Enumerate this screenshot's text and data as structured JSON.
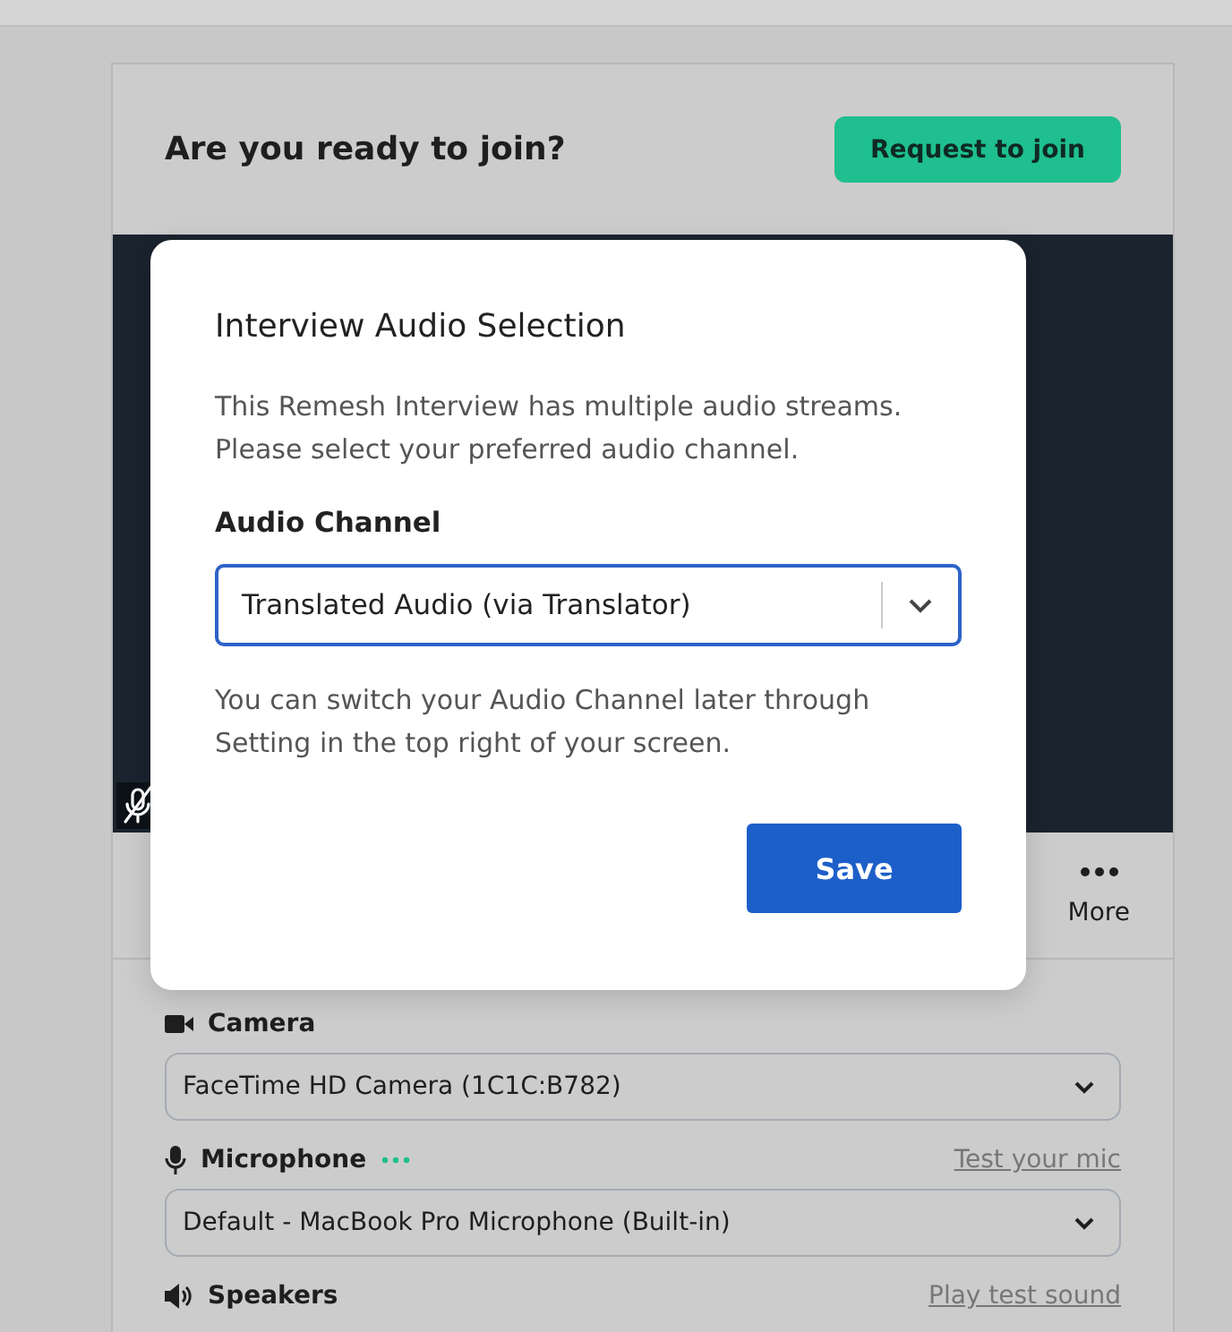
{
  "header": {
    "title": "Are you ready to join?",
    "join_button": "Request to join"
  },
  "toolbar": [
    {
      "label": "More"
    }
  ],
  "devices": [
    {
      "kind": "camera",
      "label": "Camera",
      "value": "FaceTime HD Camera (1C1C:B782)"
    },
    {
      "kind": "microphone",
      "label": "Microphone",
      "value": "Default - MacBook Pro Microphone (Built-in)",
      "action": "Test your mic"
    },
    {
      "kind": "speakers",
      "label": "Speakers",
      "action": "Play test sound"
    }
  ],
  "modal": {
    "title": "Interview Audio Selection",
    "description": "This Remesh Interview has multiple audio streams. Please select your preferred audio channel.",
    "field_label": "Audio Channel",
    "field_value": "Translated Audio (via Translator)",
    "note": "You can switch your Audio Channel later through Setting in the top right of your screen.",
    "save_button": "Save"
  }
}
